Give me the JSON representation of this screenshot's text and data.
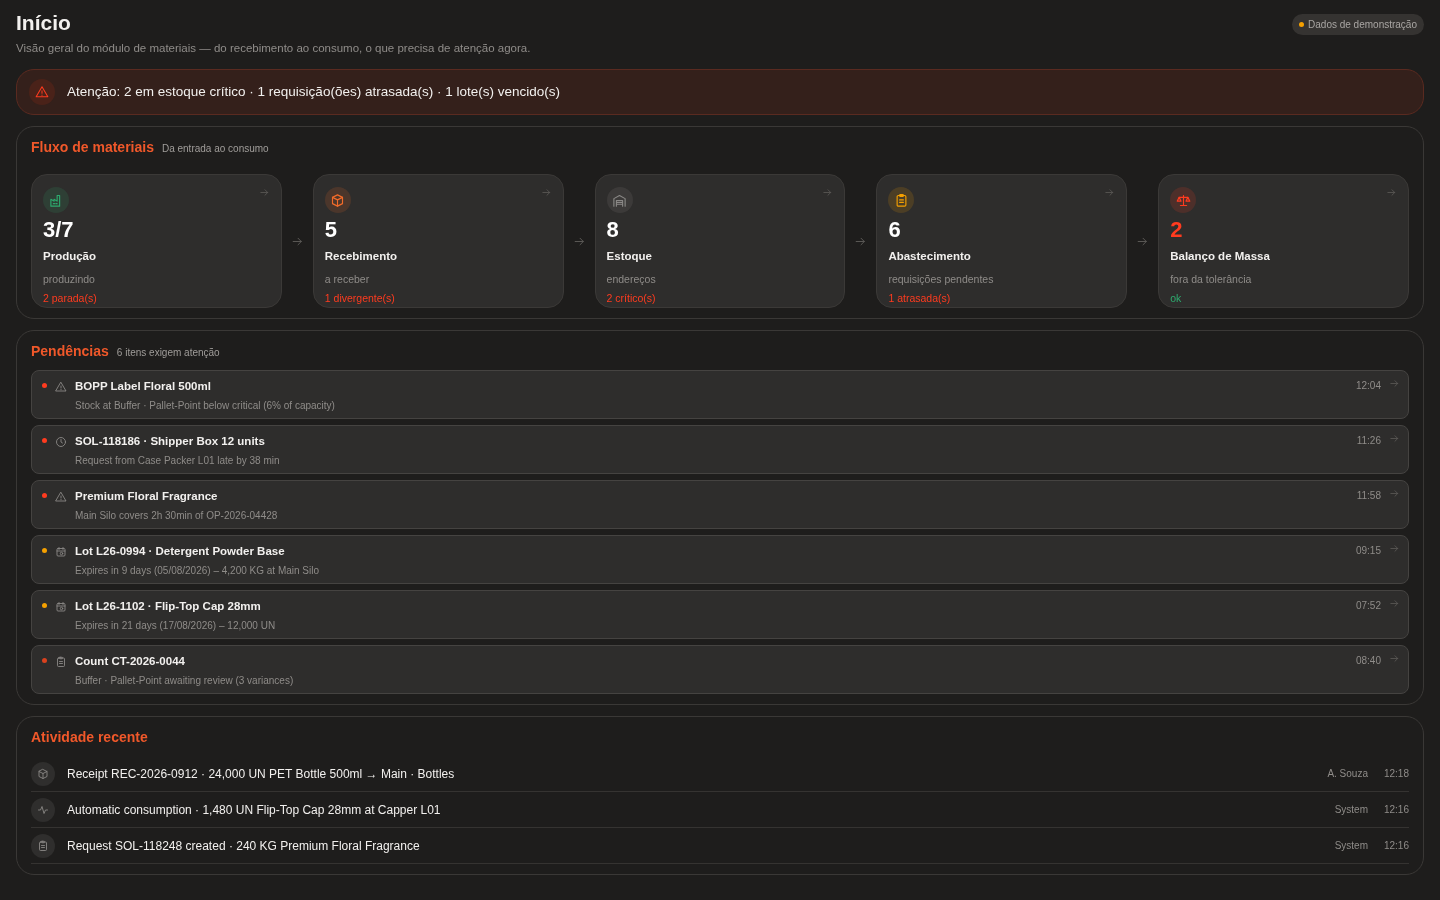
{
  "page": {
    "title": "Início",
    "subtitle": "Visão geral do módulo de materiais — do recebimento ao consumo, o que precisa de atenção agora.",
    "demo_badge": "Dados de demonstração"
  },
  "alert": {
    "text": "Atenção: 2 em estoque crítico · 1 requisição(ões) atrasada(s) · 1 lote(s) vencido(s)"
  },
  "flow": {
    "title": "Fluxo de materiais",
    "subtitle": "Da entrada ao consumo",
    "steps": [
      {
        "kind": "factory",
        "color": "#2eaa6e",
        "value": "3/7",
        "value_alert": false,
        "title": "Produção",
        "caption": "produzindo",
        "status": "2 parada(s)",
        "status_alert": true
      },
      {
        "kind": "box",
        "color": "#f26b2a",
        "value": "5",
        "value_alert": false,
        "title": "Recebimento",
        "caption": "a receber",
        "status": "1 divergente(s)",
        "status_alert": true
      },
      {
        "kind": "warehouse",
        "color": "#8a8886",
        "value": "8",
        "value_alert": false,
        "title": "Estoque",
        "caption": "endereços",
        "status": "2 crítico(s)",
        "status_alert": true
      },
      {
        "kind": "clipboard",
        "color": "#f5a000",
        "value": "6",
        "value_alert": false,
        "title": "Abastecimento",
        "caption": "requisições pendentes",
        "status": "1 atrasada(s)",
        "status_alert": true
      },
      {
        "kind": "scale",
        "color": "#ff3b1f",
        "value": "2",
        "value_alert": true,
        "title": "Balanço de Massa",
        "caption": "fora da tolerância",
        "status": "ok",
        "status_alert": false
      }
    ]
  },
  "pending": {
    "title": "Pendências",
    "subtitle": "6 itens exigem atenção",
    "items": [
      {
        "color": "#ff3b1f",
        "kind": "warning",
        "title": "BOPP Label Floral 500ml",
        "detail": "Stock at Buffer · Pallet-Point below critical (6% of capacity)",
        "time": "12:04"
      },
      {
        "color": "#ff3b1f",
        "kind": "clock",
        "title": "SOL-118186 · Shipper Box 12 units",
        "detail": "Request from Case Packer L01 late by 38 min",
        "time": "11:26"
      },
      {
        "color": "#ff3b1f",
        "kind": "warning",
        "title": "Premium Floral Fragrance",
        "detail": "Main Silo covers 2h 30min of OP-2026-04428",
        "time": "11:58"
      },
      {
        "color": "#f5a000",
        "kind": "calendar",
        "title": "Lot L26-0994 · Detergent Powder Base",
        "detail": "Expires in 9 days (05/08/2026) – 4,200 KG at Main Silo",
        "time": "09:15"
      },
      {
        "color": "#f5a000",
        "kind": "calendar",
        "title": "Lot L26-1102 · Flip-Top Cap 28mm",
        "detail": "Expires in 21 days (17/08/2026) – 12,000 UN",
        "time": "07:52"
      },
      {
        "color": "#d9411e",
        "kind": "clipboard",
        "title": "Count CT-2026-0044",
        "detail": "Buffer · Pallet-Point awaiting review (3 variances)",
        "time": "08:40"
      }
    ]
  },
  "activity": {
    "title": "Atividade recente",
    "items": [
      {
        "kind": "box",
        "text": "Receipt REC-2026-0912 · 24,000 UN PET Bottle 500ml → Main · Bottles",
        "user": "A. Souza",
        "time": "12:18"
      },
      {
        "kind": "pulse",
        "text": "Automatic consumption · 1,480 UN Flip-Top Cap 28mm at Capper L01",
        "user": "System",
        "time": "12:16"
      },
      {
        "kind": "clipboard",
        "text": "Request SOL-118248 created · 240 KG Premium Floral Fragrance",
        "user": "System",
        "time": "12:16"
      }
    ]
  }
}
